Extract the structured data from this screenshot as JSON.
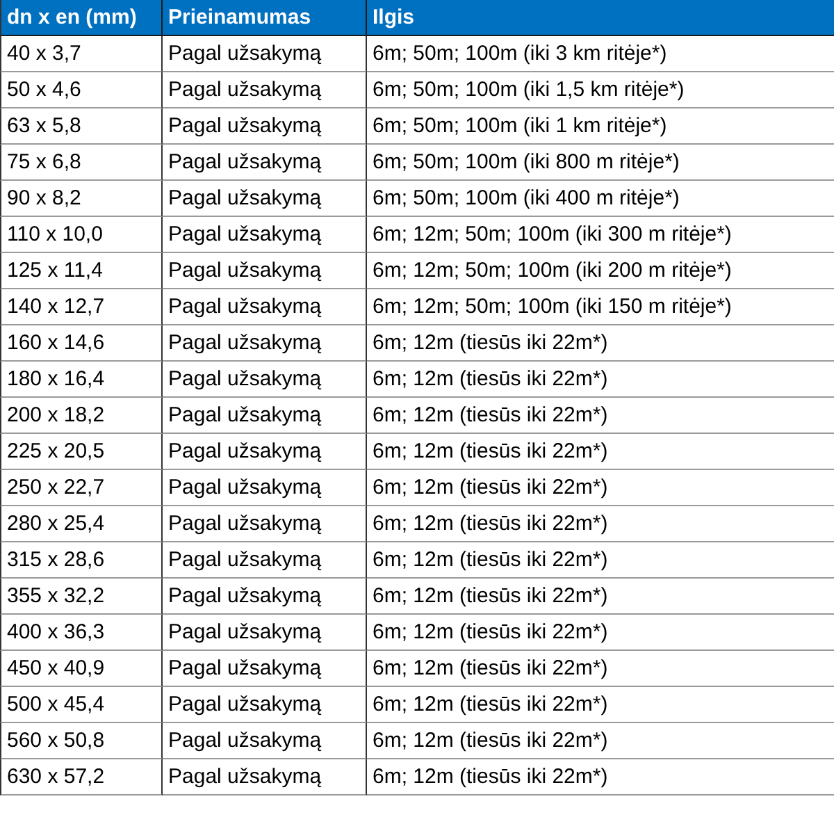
{
  "table": {
    "columns": [
      "dn x en (mm)",
      "Prieinamumas",
      "Ilgis"
    ],
    "rows": [
      [
        "40 x 3,7",
        "Pagal užsakymą",
        "6m; 50m; 100m (iki 3 km ritėje*)"
      ],
      [
        "50 x 4,6",
        "Pagal užsakymą",
        "6m; 50m; 100m (iki 1,5 km ritėje*)"
      ],
      [
        "63 x 5,8",
        "Pagal užsakymą",
        "6m; 50m; 100m (iki 1 km ritėje*)"
      ],
      [
        "75 x 6,8",
        "Pagal užsakymą",
        "6m; 50m; 100m (iki 800 m ritėje*)"
      ],
      [
        "90 x 8,2",
        "Pagal užsakymą",
        "6m; 50m; 100m (iki 400 m ritėje*)"
      ],
      [
        "110 x 10,0",
        "Pagal užsakymą",
        "6m; 12m; 50m; 100m (iki 300 m ritėje*)"
      ],
      [
        "125 x 11,4",
        "Pagal užsakymą",
        "6m; 12m; 50m; 100m (iki 200 m ritėje*)"
      ],
      [
        "140 x 12,7",
        "Pagal užsakymą",
        "6m; 12m; 50m; 100m (iki 150 m ritėje*)"
      ],
      [
        "160 x 14,6",
        "Pagal užsakymą",
        "6m; 12m (tiesūs iki 22m*)"
      ],
      [
        "180 x 16,4",
        "Pagal užsakymą",
        "6m; 12m (tiesūs iki 22m*)"
      ],
      [
        "200 x 18,2",
        "Pagal užsakymą",
        "6m; 12m (tiesūs iki 22m*)"
      ],
      [
        "225 x 20,5",
        "Pagal užsakymą",
        "6m; 12m (tiesūs iki 22m*)"
      ],
      [
        "250 x 22,7",
        "Pagal užsakymą",
        "6m; 12m (tiesūs iki 22m*)"
      ],
      [
        "280 x 25,4",
        "Pagal užsakymą",
        "6m; 12m (tiesūs iki 22m*)"
      ],
      [
        "315 x 28,6",
        "Pagal užsakymą",
        "6m; 12m (tiesūs iki 22m*)"
      ],
      [
        "355 x 32,2",
        "Pagal užsakymą",
        "6m; 12m (tiesūs iki 22m*)"
      ],
      [
        "400 x 36,3",
        "Pagal užsakymą",
        "6m; 12m (tiesūs iki 22m*)"
      ],
      [
        "450 x 40,9",
        "Pagal užsakymą",
        "6m; 12m (tiesūs iki 22m*)"
      ],
      [
        "500 x 45,4",
        "Pagal užsakymą",
        "6m; 12m (tiesūs iki 22m*)"
      ],
      [
        "560 x 50,8",
        "Pagal užsakymą",
        "6m; 12m (tiesūs iki 22m*)"
      ],
      [
        "630 x 57,2",
        "Pagal užsakymą",
        "6m; 12m (tiesūs iki 22m*)"
      ]
    ]
  }
}
